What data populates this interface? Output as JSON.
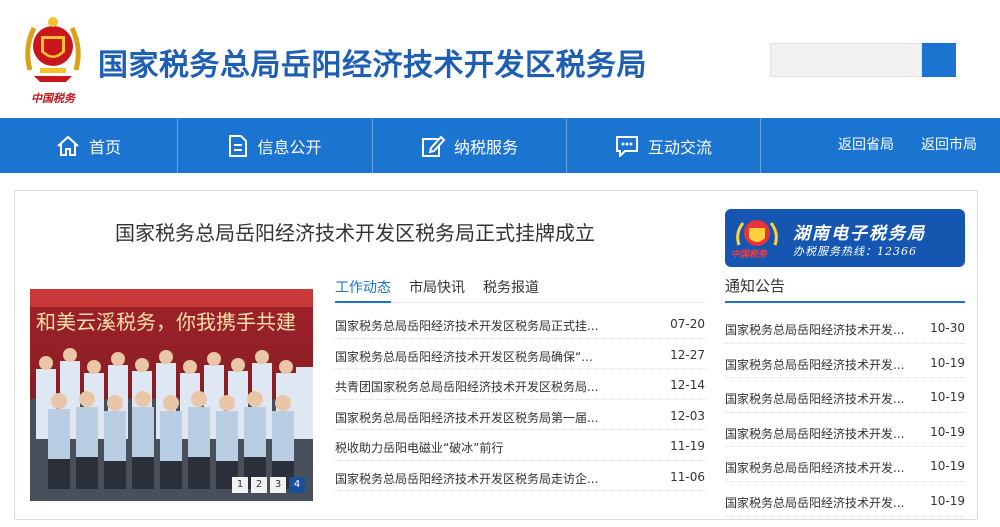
{
  "header": {
    "emblem_caption": "中国税务",
    "site_title": "国家税务总局岳阳经济技术开发区税务局",
    "search": {
      "value": "",
      "placeholder": ""
    }
  },
  "nav": {
    "items": [
      {
        "label": "首页",
        "icon": "home-icon"
      },
      {
        "label": "信息公开",
        "icon": "document-icon"
      },
      {
        "label": "纳税服务",
        "icon": "edit-icon"
      },
      {
        "label": "互动交流",
        "icon": "chat-icon"
      }
    ],
    "right_links": [
      "返回省局",
      "返回市局"
    ],
    "colors": {
      "bar": "#1a74d0"
    }
  },
  "headline": "国家税务总局岳阳经济技术开发区税务局正式挂牌成立",
  "carousel": {
    "banner_text": "和美云溪税务，你我携手共建",
    "pages": [
      "1",
      "2",
      "3",
      "4"
    ],
    "active_page": "4"
  },
  "tabs": [
    "工作动态",
    "市局快讯",
    "税务报道"
  ],
  "news": [
    {
      "title": "国家税务总局岳阳经济技术开发区税务局正式挂...",
      "date": "07-20"
    },
    {
      "title": "国家税务总局岳阳经济技术开发区税务局确保“...",
      "date": "12-27"
    },
    {
      "title": "共青团国家税务总局岳阳经济技术开发区税务局...",
      "date": "12-14"
    },
    {
      "title": "国家税务总局岳阳经济技术开发区税务局第一届...",
      "date": "12-03"
    },
    {
      "title": "税收助力岳阳电磁业“破冰”前行",
      "date": "11-19"
    },
    {
      "title": "国家税务总局岳阳经济技术开发区税务局走访企...",
      "date": "11-06"
    }
  ],
  "banner": {
    "title": "湖南电子税务局",
    "subtitle": "办税服务热线：12366",
    "emblem_text": "中国税务"
  },
  "notices": {
    "heading": "通知公告",
    "items": [
      {
        "title": "国家税务总局岳阳经济技术开发...",
        "date": "10-30"
      },
      {
        "title": "国家税务总局岳阳经济技术开发...",
        "date": "10-19"
      },
      {
        "title": "国家税务总局岳阳经济技术开发...",
        "date": "10-19"
      },
      {
        "title": "国家税务总局岳阳经济技术开发...",
        "date": "10-19"
      },
      {
        "title": "国家税务总局岳阳经济技术开发...",
        "date": "10-19"
      },
      {
        "title": "国家税务总局岳阳经济技术开发...",
        "date": "10-19"
      }
    ]
  }
}
